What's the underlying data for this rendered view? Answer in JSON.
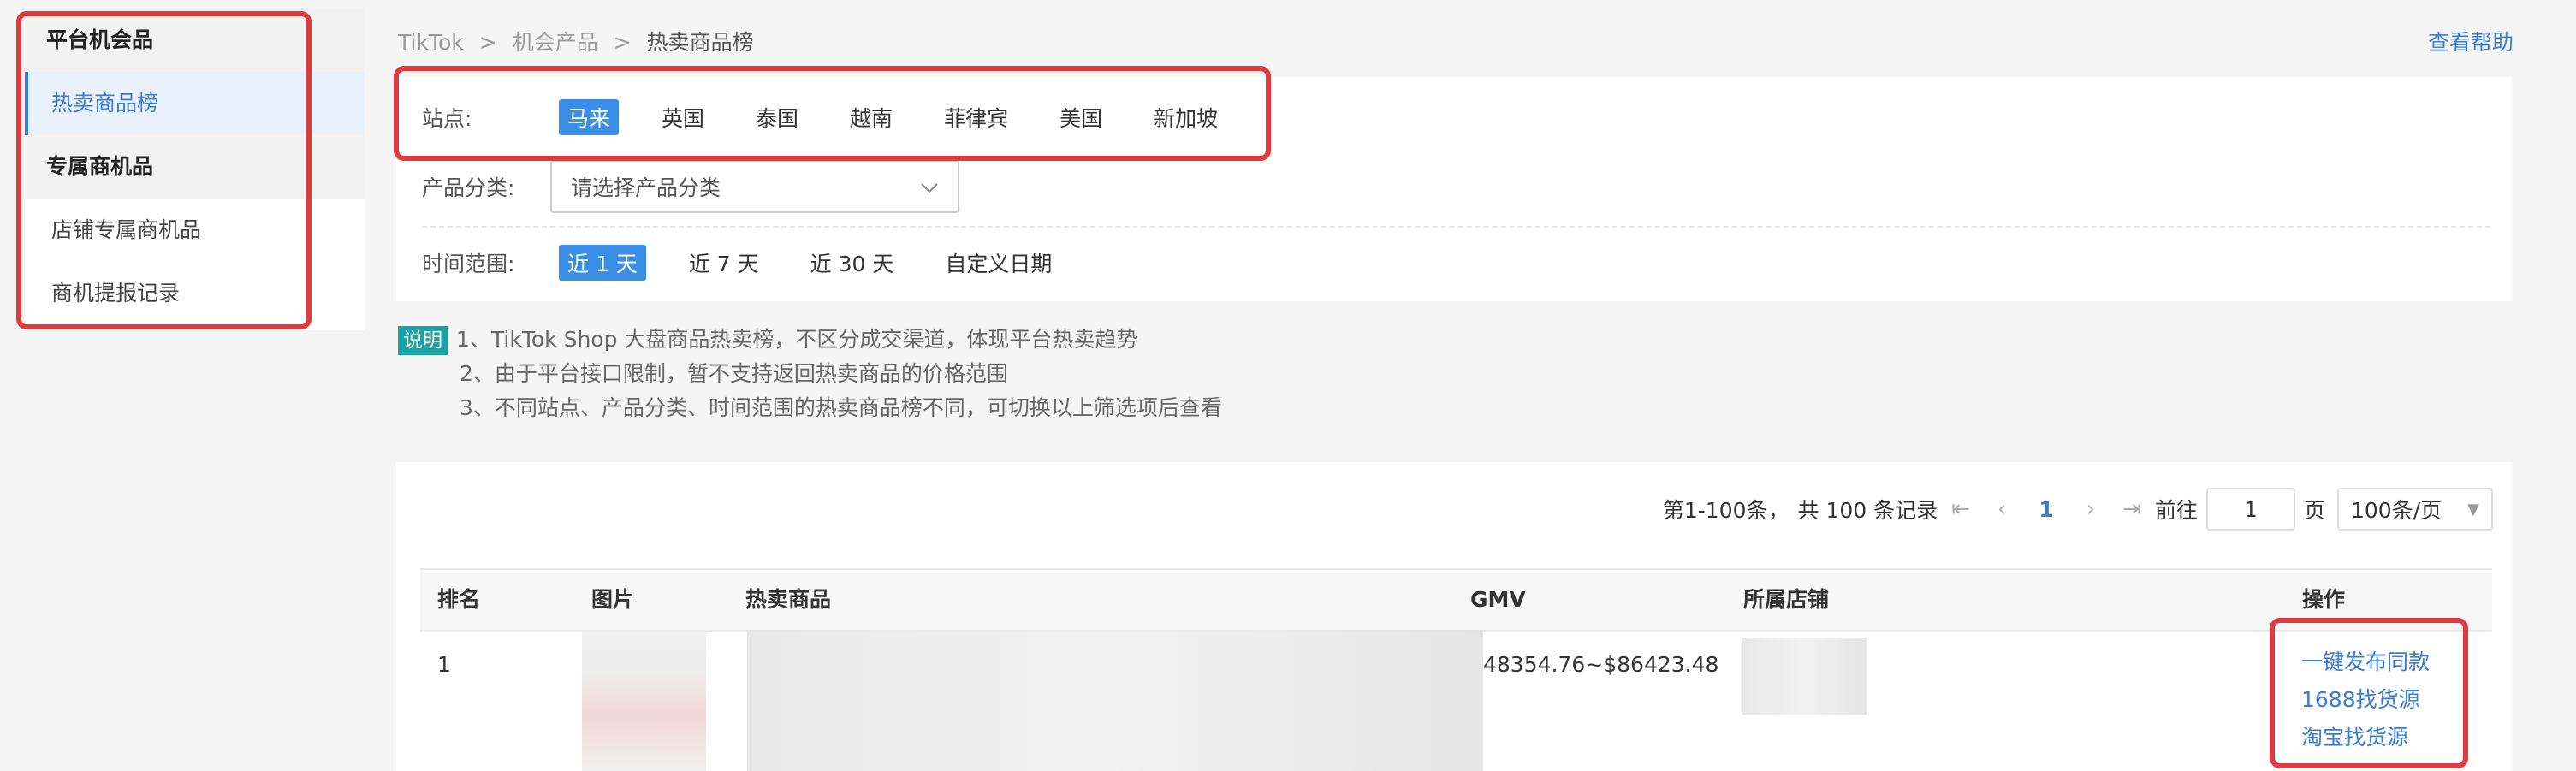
{
  "sidebar": {
    "group1": "平台机会品",
    "item_hot": "热卖商品榜",
    "group2": "专属商机品",
    "item_store": "店铺专属商机品",
    "item_report": "商机提报记录"
  },
  "breadcrumb": [
    "TikTok",
    ">",
    "机会产品",
    ">",
    "热卖商品榜"
  ],
  "help": "查看帮助",
  "filters": {
    "site_label": "站点:",
    "sites": [
      "马来",
      "英国",
      "泰国",
      "越南",
      "菲律宾",
      "美国",
      "新加坡"
    ],
    "category_label": "产品分类:",
    "category_placeholder": "请选择产品分类",
    "time_label": "时间范围:",
    "times": [
      "近 1 天",
      "近 7 天",
      "近 30 天",
      "自定义日期"
    ]
  },
  "notes": {
    "badge": "说明",
    "lines": [
      "1、TikTok Shop 大盘商品热卖榜，不区分成交渠道，体现平台热卖趋势",
      "2、由于平台接口限制，暂不支持返回热卖商品的价格范围",
      "3、不同站点、产品分类、时间范围的热卖商品榜不同，可切换以上筛选项后查看"
    ]
  },
  "pager": {
    "range": "第1-100条，",
    "total": "共 100 条记录",
    "current": "1",
    "goto_label": "前往",
    "goto_value": "1",
    "page_unit": "页",
    "page_size": "100条/页"
  },
  "table": {
    "headers": [
      "排名",
      "图片",
      "热卖商品",
      "GMV",
      "所属店铺",
      "操作"
    ],
    "rows": [
      {
        "rank": "1",
        "gmv": "48354.76~$86423.48"
      }
    ],
    "actions": [
      "一键发布同款",
      "1688找货源",
      "淘宝找货源"
    ]
  },
  "colors": {
    "accent": "#3a7bd5",
    "highlight": "#e0393e",
    "badge": "#1aa3a3"
  }
}
